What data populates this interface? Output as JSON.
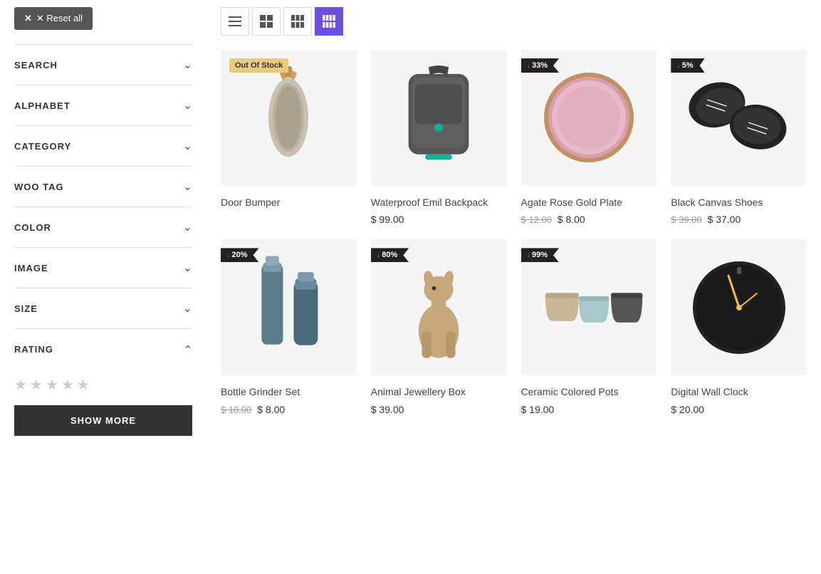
{
  "sidebar": {
    "reset_button": "✕ Reset all",
    "filters": [
      {
        "label": "SEARCH",
        "chevron": "down",
        "expanded": false
      },
      {
        "label": "ALPHABET",
        "chevron": "down",
        "expanded": false
      },
      {
        "label": "CATEGORY",
        "chevron": "down",
        "expanded": false
      },
      {
        "label": "WOO TAG",
        "chevron": "down",
        "expanded": false
      },
      {
        "label": "COLOR",
        "chevron": "down",
        "expanded": false
      },
      {
        "label": "IMAGE",
        "chevron": "down",
        "expanded": false
      },
      {
        "label": "SIZE",
        "chevron": "down",
        "expanded": false
      },
      {
        "label": "RATING",
        "chevron": "up",
        "expanded": true
      }
    ],
    "show_more": "SHOW MORE"
  },
  "view_toggles": [
    {
      "icon": "list",
      "active": false
    },
    {
      "icon": "grid2",
      "active": false
    },
    {
      "icon": "grid3",
      "active": false
    },
    {
      "icon": "grid4",
      "active": true
    }
  ],
  "products": [
    {
      "name": "Door Bumper",
      "badge_type": "out_stock",
      "badge_text": "Out Of Stock",
      "price_single": null,
      "price_original": null,
      "price_current": null,
      "price_display": "",
      "color": "#e8e8e8"
    },
    {
      "name": "Waterproof Emil Backpack",
      "badge_type": null,
      "badge_text": null,
      "price_single": "$ 99.00",
      "price_original": null,
      "price_current": null,
      "color": "#ddd"
    },
    {
      "name": "Agate Rose Gold Plate",
      "badge_type": "discount",
      "badge_text": "33%",
      "price_single": null,
      "price_original": "$ 12.00",
      "price_current": "$ 8.00",
      "color": "#f0f0f0"
    },
    {
      "name": "Black Canvas Shoes",
      "badge_type": "discount",
      "badge_text": "5%",
      "price_single": null,
      "price_original": "$ 39.00",
      "price_current": "$ 37.00",
      "color": "#eee"
    },
    {
      "name": "Bottle Grinder Set",
      "badge_type": "discount",
      "badge_text": "20%",
      "price_single": null,
      "price_original": "$ 10.00",
      "price_current": "$ 8.00",
      "color": "#f5f5f5"
    },
    {
      "name": "Animal Jewellery Box",
      "badge_type": "discount",
      "badge_text": "80%",
      "price_single": "$ 39.00",
      "price_original": null,
      "price_current": null,
      "color": "#f5f0e8"
    },
    {
      "name": "Ceramic Colored Pots",
      "badge_type": "discount",
      "badge_text": "99%",
      "price_single": "$ 19.00",
      "price_original": null,
      "price_current": null,
      "color": "#f5f5f5"
    },
    {
      "name": "Digital Wall Clock",
      "badge_type": null,
      "badge_text": null,
      "price_single": "$ 20.00",
      "price_original": null,
      "price_current": null,
      "color": "#f0f0f0"
    }
  ],
  "colors": {
    "active_toggle": "#6c4ee0",
    "discount_badge_bg": "#222",
    "out_stock_bg": "#e8c97e"
  }
}
